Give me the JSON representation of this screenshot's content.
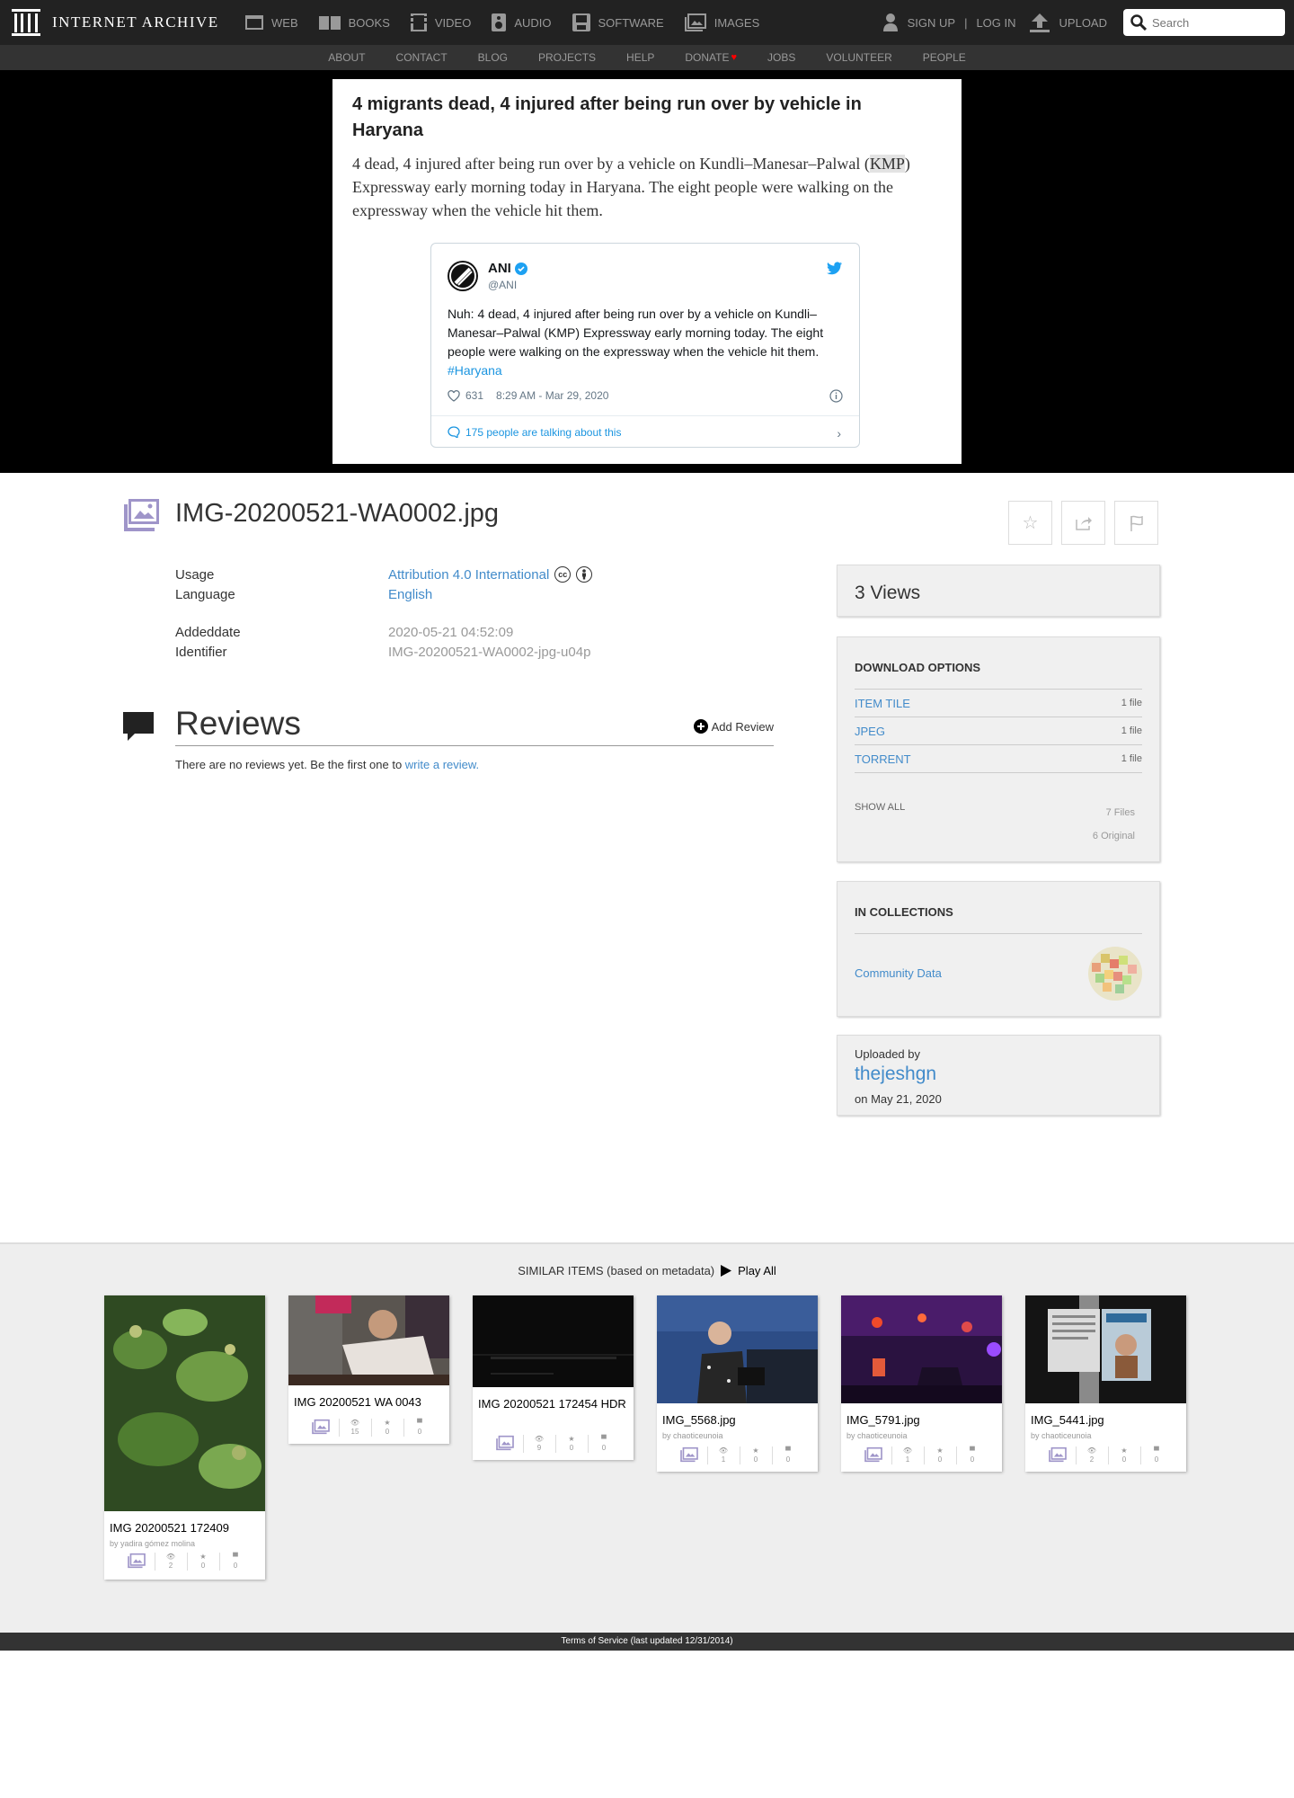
{
  "header": {
    "logo_text": "INTERNET ARCHIVE",
    "mediatypes": [
      {
        "label": "WEB",
        "icon": "web-icon"
      },
      {
        "label": "BOOKS",
        "icon": "books-icon"
      },
      {
        "label": "VIDEO",
        "icon": "video-icon"
      },
      {
        "label": "AUDIO",
        "icon": "audio-icon"
      },
      {
        "label": "SOFTWARE",
        "icon": "software-icon"
      },
      {
        "label": "IMAGES",
        "icon": "images-icon"
      }
    ],
    "signup": "SIGN UP",
    "separator": "|",
    "login": "LOG IN",
    "upload": "UPLOAD",
    "search_placeholder": "Search"
  },
  "subnav": [
    "ABOUT",
    "CONTACT",
    "BLOG",
    "PROJECTS",
    "HELP",
    "DONATE",
    "JOBS",
    "VOLUNTEER",
    "PEOPLE"
  ],
  "article": {
    "title": "4 migrants dead, 4 injured after being run over by vehicle in Haryana",
    "body_before": "4 dead, 4 injured after being run over by a vehicle on Kundli–Manesar–Palwal (",
    "body_highlight": "KMP",
    "body_after": ") Expressway early morning today in Haryana. The eight people were walking on the expressway when the vehicle hit them.",
    "tweet": {
      "name": "ANI",
      "handle": "@ANI",
      "text": "Nuh: 4 dead, 4 injured after being run over by a vehicle on Kundli–Manesar–Palwal (KMP) Expressway early morning today. The eight people were walking on the expressway when the vehicle hit them.",
      "hashtag": "#Haryana",
      "likes": "631",
      "time": "8:29 AM - Mar 29, 2020",
      "talking": "175 people are talking about this"
    }
  },
  "item": {
    "title": "IMG-20200521-WA0002.jpg",
    "metadata": [
      {
        "label": "Usage",
        "value": "Attribution 4.0 International"
      },
      {
        "label": "Language",
        "value": "English"
      },
      {
        "label": "Addeddate",
        "value": "2020-05-21 04:52:09"
      },
      {
        "label": "Identifier",
        "value": "IMG-20200521-WA0002-jpg-u04p"
      }
    ],
    "cc_badges": [
      "cc",
      "by"
    ]
  },
  "reviews": {
    "title": "Reviews",
    "add_label": "Add Review",
    "empty_text": "There are no reviews yet. Be the first one to ",
    "empty_link": "write a review."
  },
  "sidebar": {
    "views": "3 Views",
    "download": {
      "heading": "DOWNLOAD OPTIONS",
      "rows": [
        {
          "label": "ITEM TILE",
          "count": "1 file"
        },
        {
          "label": "JPEG",
          "count": "1 file"
        },
        {
          "label": "TORRENT",
          "count": "1 file"
        }
      ],
      "show_all": "SHOW ALL",
      "total_files": "7 Files",
      "original": "6 Original"
    },
    "collections": {
      "heading": "IN COLLECTIONS",
      "item": "Community Data"
    },
    "uploader": {
      "label": "Uploaded by",
      "name": "thejeshgn",
      "date": "on May 21, 2020"
    }
  },
  "similar": {
    "heading": "SIMILAR ITEMS (based on metadata)",
    "play_all": "Play All",
    "items": [
      {
        "title": "IMG 20200521 172409",
        "by": "by yadira gómez molina",
        "views": "2",
        "favs": "0",
        "reviews": "0"
      },
      {
        "title": "IMG 20200521 WA 0043",
        "by": "",
        "views": "15",
        "favs": "0",
        "reviews": "0"
      },
      {
        "title": "IMG 20200521 172454 HDR",
        "by": "",
        "views": "9",
        "favs": "0",
        "reviews": "0"
      },
      {
        "title": "IMG_5568.jpg",
        "by": "by chaoticeunoia",
        "views": "1",
        "favs": "0",
        "reviews": "0"
      },
      {
        "title": "IMG_5791.jpg",
        "by": "by chaoticeunoia",
        "views": "1",
        "favs": "0",
        "reviews": "0"
      },
      {
        "title": "IMG_5441.jpg",
        "by": "by chaoticeunoia",
        "views": "2",
        "favs": "0",
        "reviews": "0"
      }
    ]
  },
  "footer": {
    "text": "Terms of Service (last updated 12/31/2014)"
  },
  "colors": {
    "link": "#428bca",
    "topbar": "#222222",
    "subnav": "#333333",
    "donate_heart": "#ff0000",
    "images_icon": "#9f95c9"
  }
}
